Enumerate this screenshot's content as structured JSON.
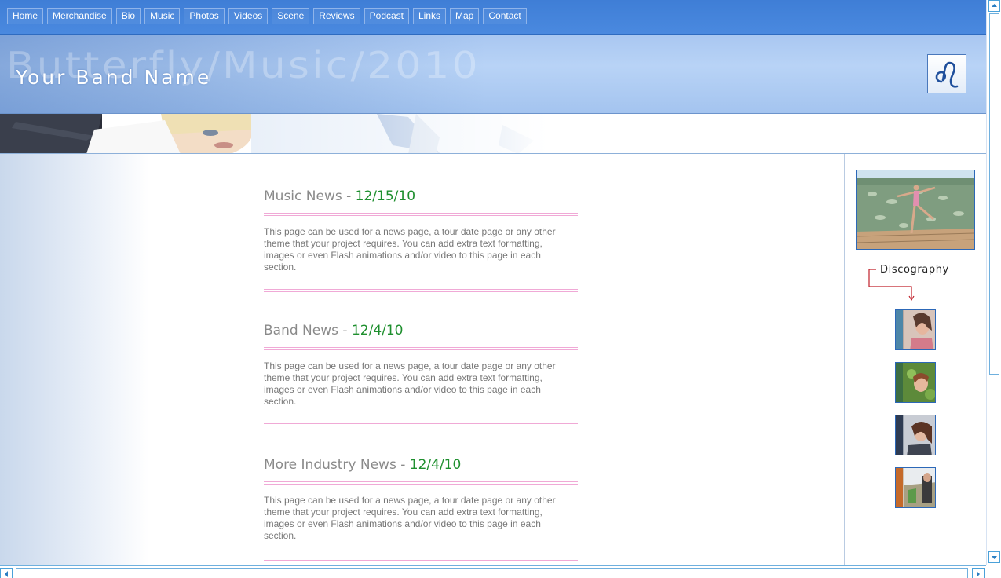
{
  "nav": {
    "items": [
      "Home",
      "Merchandise",
      "Bio",
      "Music",
      "Photos",
      "Videos",
      "Scene",
      "Reviews",
      "Podcast",
      "Links",
      "Map",
      "Contact"
    ]
  },
  "header": {
    "site_title": "ButterflyMusic2010",
    "site_title_display": "Butterfly/Music/2010",
    "band_name": "Your Band Name",
    "logo_icon": "leo-zodiac-icon"
  },
  "news": [
    {
      "title": "Music News",
      "separator": " - ",
      "date": "12/15/10",
      "body": "This page can be used for a news page, a tour date page or any other theme that your project requires. You can add extra text formatting, images or even Flash animations and/or video to this page in each section."
    },
    {
      "title": "Band News",
      "separator": " - ",
      "date": "12/4/10",
      "body": "This page can be used for a news page, a tour date page or any other theme that your project requires. You can add extra text formatting, images or even Flash animations and/or video to this page in each section."
    },
    {
      "title": "More Industry News",
      "separator": " - ",
      "date": "12/4/10",
      "body": "This page can be used for a news page, a tour date page or any other theme that your project requires. You can add extra text formatting, images or even Flash animations and/or video to this page in each section."
    }
  ],
  "sidebar": {
    "discography_label": "Discography"
  },
  "colors": {
    "nav_bg": "#3f7ed6",
    "header_bg": "#b8d3f6",
    "date_green": "#1e8f2e",
    "rule_pink": "#f0a9d6"
  }
}
